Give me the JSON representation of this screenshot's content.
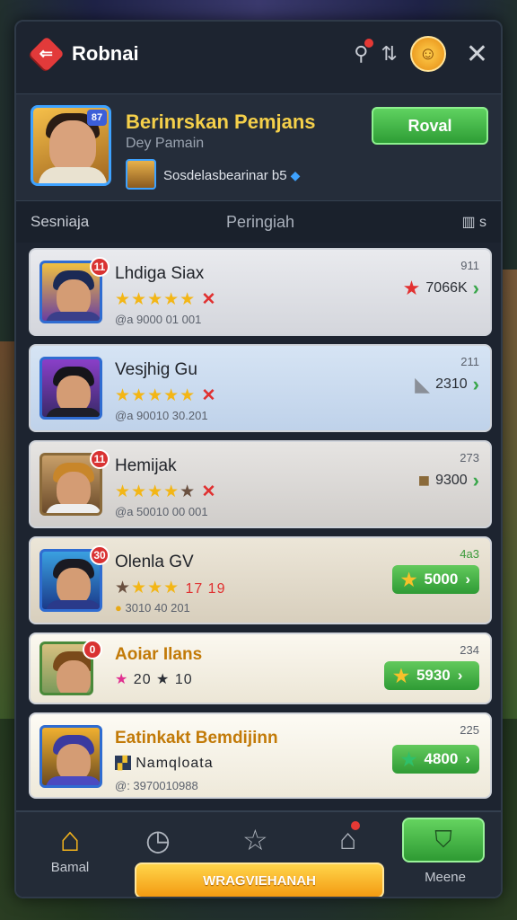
{
  "header": {
    "title": "Robnai",
    "close_symbol": "✕"
  },
  "profile": {
    "name": "Berinrskan Pemjans",
    "subtitle": "Dey Pamain",
    "level_badge": "87",
    "guild": "Sosdelasbearinar b5",
    "action_label": "Roval"
  },
  "columns": {
    "left": "Sesniaja",
    "middle": "Peringiah",
    "right_icon": "book-icon",
    "right_text": "s"
  },
  "rows": [
    {
      "rank": "11",
      "name": "Lhdiga Siax",
      "stars_on": 5,
      "stars_off": 0,
      "x": true,
      "sub": "@a 9000 01 001",
      "num": "911",
      "score": "7066K",
      "score_icon": "red-star"
    },
    {
      "rank": "",
      "name": "Vesjhig Gu",
      "stars_on": 5,
      "stars_off": 0,
      "x": true,
      "sub": "@a 90010 30.201",
      "num": "211",
      "score": "2310",
      "score_icon": "wing"
    },
    {
      "rank": "11",
      "name": "Hemijak",
      "stars_on": 4,
      "stars_off": 1,
      "x": true,
      "sub": "@a 50010 00 001",
      "num": "273",
      "score": "9300",
      "score_icon": "crate"
    },
    {
      "rank": "30",
      "name": "Olenla GV",
      "stars_on": 3,
      "stars_off": 1,
      "x": false,
      "extra": "17 19",
      "sub": "3010 40 201",
      "num": "4a3",
      "score": "5000",
      "score_icon": "gold-star"
    },
    {
      "rank": "0",
      "name": "Aoiar Ilans",
      "stars_on": 0,
      "stars_off": 0,
      "x": false,
      "extra": "20 ★ 10",
      "sub": "",
      "num": "234",
      "score": "5930",
      "score_icon": "gold-star"
    },
    {
      "rank": "",
      "name": "Eatinkakt Bemdijinn",
      "stars_on": 0,
      "stars_off": 0,
      "x": false,
      "tag": "Namqloata",
      "sub": "@: 3970010988",
      "num": "225",
      "score": "4800",
      "score_icon": "green-star"
    }
  ],
  "nav": {
    "home_label": "Bamal",
    "main_button": "WRAGVIEHANAH",
    "right_label": "Meene"
  },
  "colors": {
    "accent_gold": "#f5d04a",
    "accent_green": "#3aa63f",
    "accent_red": "#e23a3a"
  }
}
